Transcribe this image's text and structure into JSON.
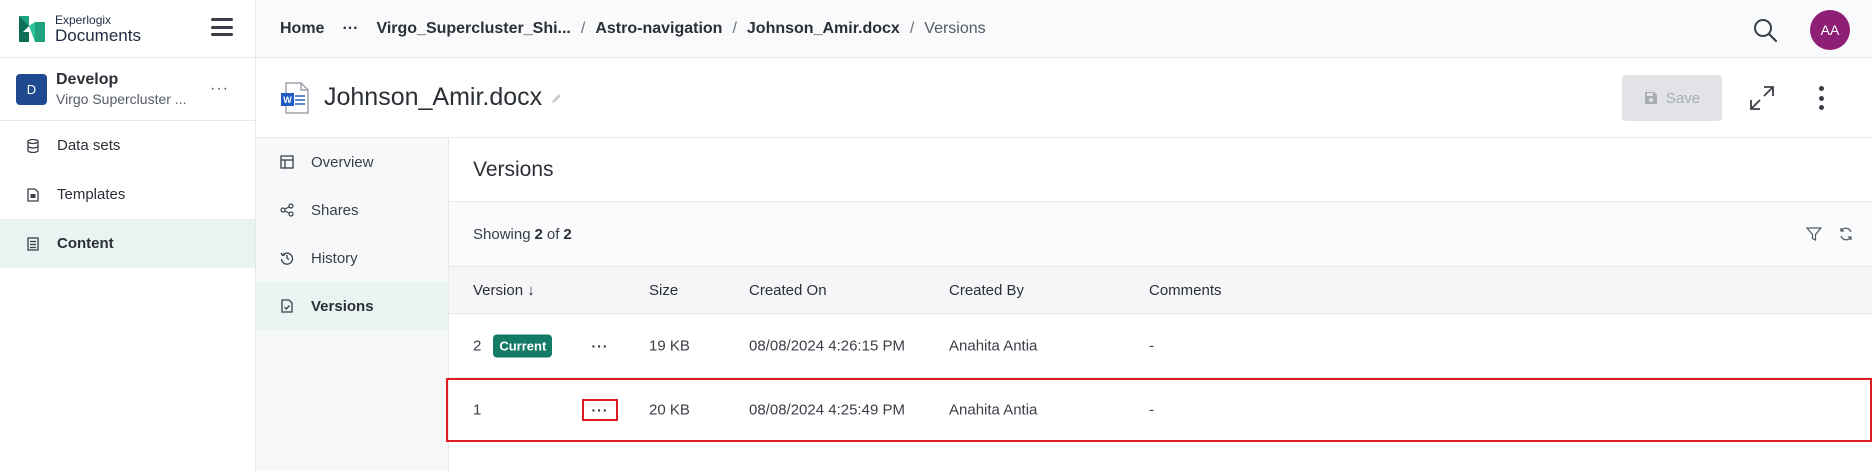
{
  "logo": {
    "line1": "Experlogix",
    "line2": "Documents"
  },
  "project": {
    "badge": "D",
    "name": "Develop",
    "subtitle": "Virgo Supercluster ..."
  },
  "sidebar": {
    "items": [
      {
        "label": "Data sets",
        "icon": "database-icon"
      },
      {
        "label": "Templates",
        "icon": "template-icon"
      },
      {
        "label": "Content",
        "icon": "content-icon",
        "active": true
      }
    ]
  },
  "breadcrumb": {
    "home": "Home",
    "dots": "···",
    "items": [
      "Virgo_Supercluster_Shi...",
      "Astro-navigation",
      "Johnson_Amir.docx"
    ],
    "current": "Versions",
    "sep": "/"
  },
  "user": {
    "initials": "AA"
  },
  "document": {
    "title": "Johnson_Amir.docx"
  },
  "toolbar": {
    "save_label": "Save"
  },
  "subnav": {
    "items": [
      {
        "label": "Overview",
        "icon": "grid-icon"
      },
      {
        "label": "Shares",
        "icon": "share-icon"
      },
      {
        "label": "History",
        "icon": "history-icon"
      },
      {
        "label": "Versions",
        "icon": "file-check-icon",
        "active": true
      }
    ]
  },
  "main": {
    "title": "Versions",
    "showing": {
      "prefix": "Showing",
      "count": "2",
      "of": "of",
      "total": "2"
    }
  },
  "table": {
    "headers": {
      "version": "Version ↓",
      "size": "Size",
      "created_on": "Created On",
      "created_by": "Created By",
      "comments": "Comments"
    },
    "rows": [
      {
        "version": "2",
        "badge": "Current",
        "more": "···",
        "size": "19 KB",
        "created_on": "08/08/2024 4:26:15 PM",
        "created_by": "Anahita Antia",
        "comments": "-"
      },
      {
        "version": "1",
        "badge": "",
        "more": "···",
        "size": "20 KB",
        "created_on": "08/08/2024 4:25:49 PM",
        "created_by": "Anahita Antia",
        "comments": "-"
      }
    ]
  },
  "colors": {
    "accent": "#137a65",
    "avatar": "#8e1f75",
    "project_badge": "#1f4a8f",
    "highlight": "#e11b22"
  }
}
